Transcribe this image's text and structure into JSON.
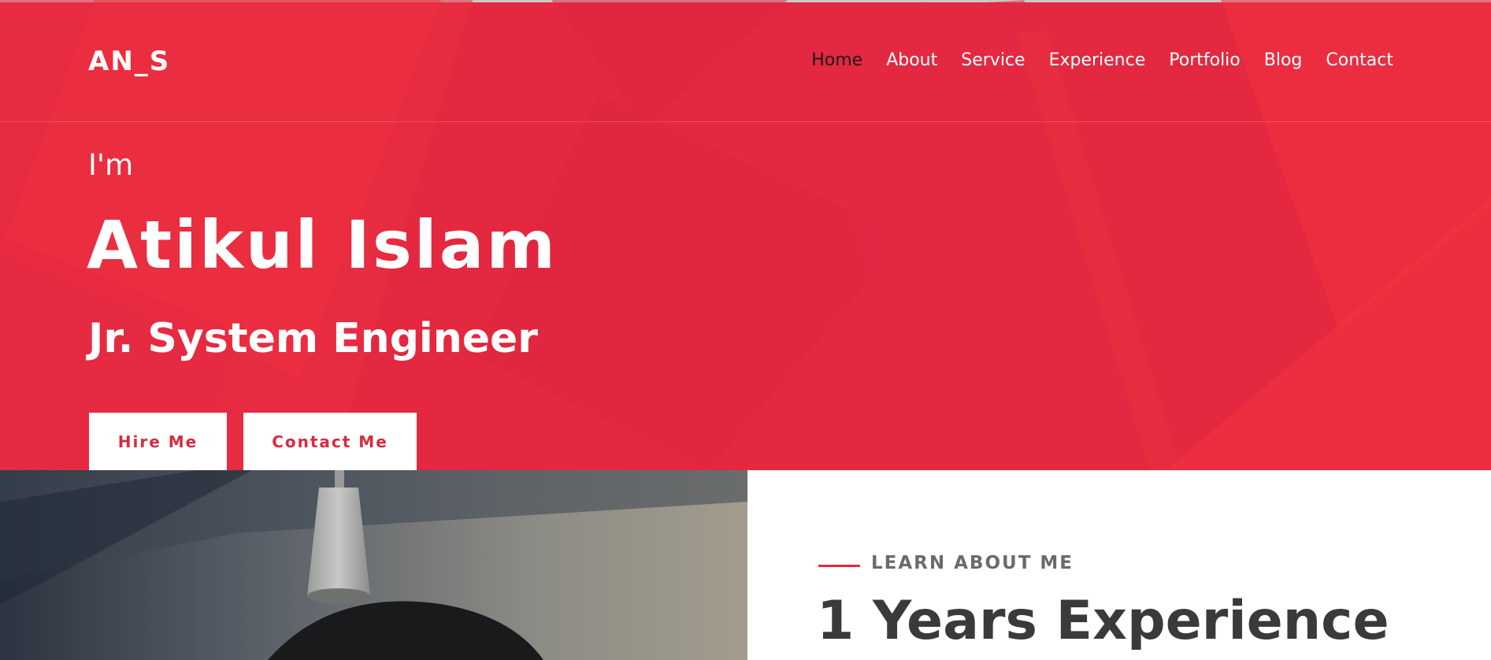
{
  "brand": {
    "logo": "AN_S"
  },
  "nav": {
    "items": [
      "Home",
      "About",
      "Service",
      "Experience",
      "Portfolio",
      "Blog",
      "Contact"
    ],
    "active": "Home"
  },
  "hero": {
    "intro": "I'm",
    "name": "Atikul Islam",
    "role": "Jr. System Engineer",
    "buttons": {
      "hire": "Hire Me",
      "contact": "Contact Me"
    }
  },
  "about": {
    "label": "LEARN ABOUT ME",
    "heading": "1 Years Experience"
  },
  "colors": {
    "accent": "#e4283f",
    "button_text": "#d72a40",
    "heading_text": "#3a3a3a",
    "label_text": "#6b6b6b"
  }
}
